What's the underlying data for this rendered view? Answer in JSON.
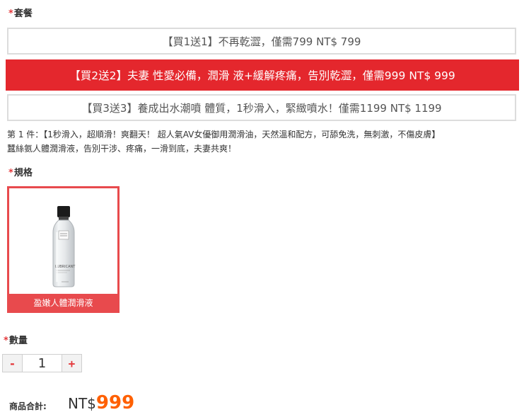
{
  "package": {
    "required_mark": "*",
    "label": "套餐",
    "options": [
      {
        "text": "【買1送1】不再乾澀，僅需799 NT$ 799",
        "selected": false
      },
      {
        "text": "【買2送2】夫妻 性愛必備，潤滑 液+緩解疼痛，告別乾澀，僅需999 NT$ 999",
        "selected": true
      },
      {
        "text": "【買3送3】養成出水潮噴 體質，1秒滑入，緊緻噴水！僅需1199 NT$ 1199",
        "selected": false
      }
    ],
    "description_line1": "第 1 件：【1秒滑入，超順滑！爽翻天！ 超人氣AV女優御用潤滑油，天然溫和配方，可舔免洗，無刺激，不傷皮膚】",
    "description_line2": "蠶絲氨人體潤滑液，告別干涉、疼痛，一滑到底，夫妻共爽！"
  },
  "spec": {
    "required_mark": "*",
    "label": "規格",
    "item": {
      "name": "盈嫩人體潤滑液",
      "bottle_text": "LUBRICANT"
    }
  },
  "quantity": {
    "required_mark": "*",
    "label": "數量",
    "minus": "-",
    "value": "1",
    "plus": "+"
  },
  "total": {
    "label": "商品合計:",
    "currency": "NT$",
    "amount": "999"
  },
  "colors": {
    "accent_red": "#e4272d",
    "price_orange": "#ff6000"
  }
}
